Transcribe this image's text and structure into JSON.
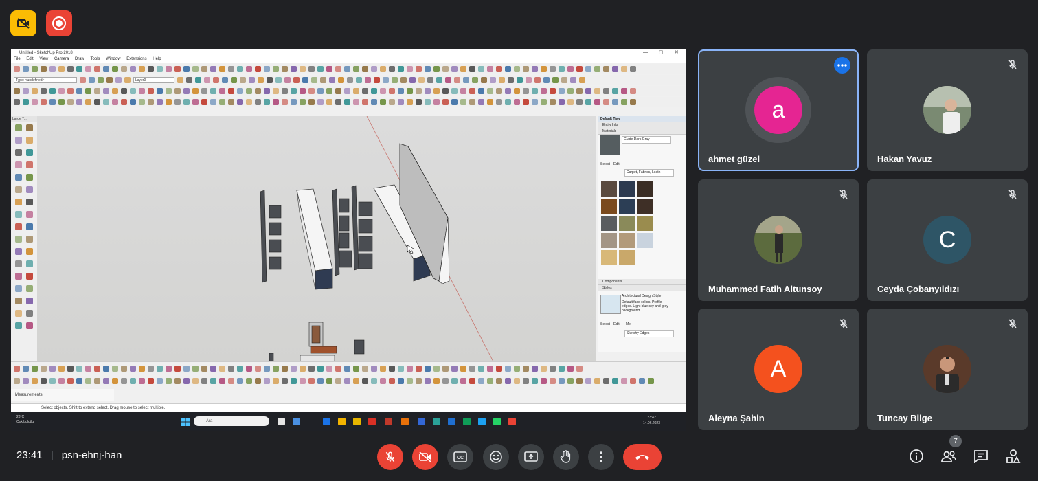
{
  "meeting": {
    "time": "23:41",
    "code": "psn-ehnj-han",
    "participant_count": "7"
  },
  "top_badges": {
    "camera_off_icon": "camera-off-icon",
    "recording_icon": "recording-icon"
  },
  "participants": [
    {
      "name": "ahmet güzel",
      "initial": "a",
      "avatar_color": "#e52592",
      "has_photo": false,
      "muted": false,
      "speaking": true
    },
    {
      "name": "Hakan Yavuz",
      "initial": "",
      "has_photo": true,
      "muted": true
    },
    {
      "name": "Muhammed Fatih Altunsoy",
      "initial": "",
      "has_photo": true,
      "muted": true
    },
    {
      "name": "Ceyda Çobanyıldızı",
      "initial": "C",
      "avatar_color": "#2e5566",
      "has_photo": false,
      "muted": true
    },
    {
      "name": "Aleyna Şahin",
      "initial": "A",
      "avatar_color": "#f4511e",
      "has_photo": false,
      "muted": true
    },
    {
      "name": "Tuncay Bilge",
      "initial": "",
      "has_photo": true,
      "muted": true
    }
  ],
  "shared_screen": {
    "window_title": "Untitled - SketchUp Pro 2018",
    "menu": [
      "File",
      "Edit",
      "View",
      "Camera",
      "Draw",
      "Tools",
      "Window",
      "Extensions",
      "Help"
    ],
    "type_combo": "Type: <undefined>",
    "layer_combo": "Layer0",
    "left_toolbar_title": "Large T...",
    "tray": {
      "title": "Default Tray",
      "sections": [
        "Entity Info",
        "Materials",
        "Components",
        "Styles"
      ],
      "material_name": "Guide Dark Gray",
      "select_label": "Select",
      "edit_label": "Edit",
      "mix_label": "Mix",
      "materials_category": "Carpet, Fabrics, Leath",
      "style_name": "Architectural Design Style",
      "style_desc": "Default face colors. Profile edges. Light blue sky and gray background.",
      "styles_category": "Sketchy Edges"
    },
    "measurements_label": "Measurements",
    "status_text": "Select objects. Shift to extend select. Drag mouse to select multiple.",
    "taskbar": {
      "weather_temp": "28°C",
      "weather_desc": "Çok bulutlu",
      "search_placeholder": "Ara",
      "clock_time": "23:42",
      "clock_date": "14.06.2023"
    }
  },
  "colors": {
    "background": "#202124",
    "tile": "#3c4043",
    "danger": "#ea4335",
    "accent": "#8ab4f8",
    "badge_yellow": "#fbbc04"
  }
}
